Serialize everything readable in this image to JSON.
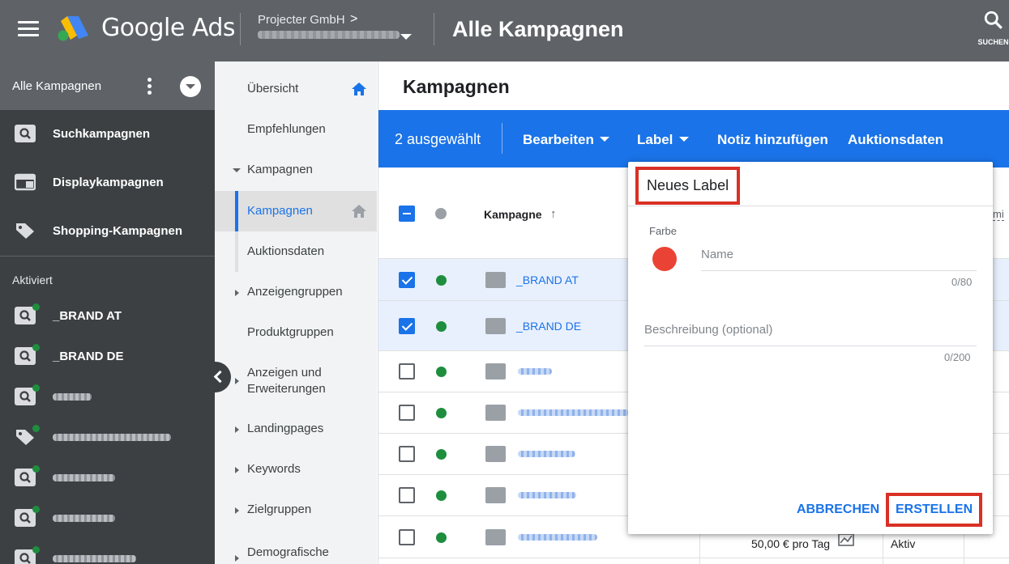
{
  "header": {
    "app_name": "Google Ads",
    "account_name": "Projecter GmbH",
    "account_chevron": ">",
    "page_title": "Alle Kampagnen",
    "search_label": "SUCHEN"
  },
  "sidebar": {
    "title": "Alle Kampagnen",
    "types": [
      {
        "label": "Suchkampagnen",
        "icon": "search-campaign-icon"
      },
      {
        "label": "Displaykampagnen",
        "icon": "display-campaign-icon"
      },
      {
        "label": "Shopping-Kampagnen",
        "icon": "shopping-tag-icon"
      }
    ],
    "section_label": "Aktiviert",
    "campaigns": [
      {
        "label": "_BRAND AT",
        "icon": "search-campaign-icon"
      },
      {
        "label": "_BRAND DE",
        "icon": "search-campaign-icon"
      }
    ]
  },
  "nav": {
    "items": [
      {
        "label": "Übersicht"
      },
      {
        "label": "Empfehlungen"
      },
      {
        "label": "Kampagnen"
      },
      {
        "label": "Kampagnen"
      },
      {
        "label": "Auktionsdaten"
      },
      {
        "label": "Anzeigengruppen"
      },
      {
        "label": "Produktgruppen"
      },
      {
        "label": "Anzeigen und"
      },
      {
        "label": "Erweiterungen"
      },
      {
        "label": "Landingpages"
      },
      {
        "label": "Keywords"
      },
      {
        "label": "Zielgruppen"
      },
      {
        "label": "Demografische"
      }
    ]
  },
  "main": {
    "title": "Kampagnen",
    "action_bar": {
      "selected": "2 ausgewählt",
      "edit": "Bearbeiten",
      "label": "Label",
      "add_note": "Notiz hinzufügen",
      "auction": "Auktionsdaten"
    },
    "table": {
      "col_campaign": "Kampagne",
      "sort_arrow": "↑",
      "col_right_partial": "mi",
      "rows": [
        {
          "name": "_BRAND AT",
          "selected": true
        },
        {
          "name": "_BRAND DE",
          "selected": true
        }
      ],
      "budget": "50,00 € pro Tag",
      "status": "Aktiv"
    }
  },
  "popup": {
    "title": "Neues Label",
    "color_label": "Farbe",
    "color": "#ea4335",
    "name_placeholder": "Name",
    "name_count": "0/80",
    "desc_placeholder": "Beschreibung (optional)",
    "desc_count": "0/200",
    "cancel": "ABBRECHEN",
    "create": "ERSTELLEN"
  },
  "colors": {
    "accent": "#1a73e8",
    "topbar": "#5f6368",
    "sidebar": "#3c4043",
    "status_green": "#1e8e3e",
    "highlight_red": "#d93025"
  }
}
